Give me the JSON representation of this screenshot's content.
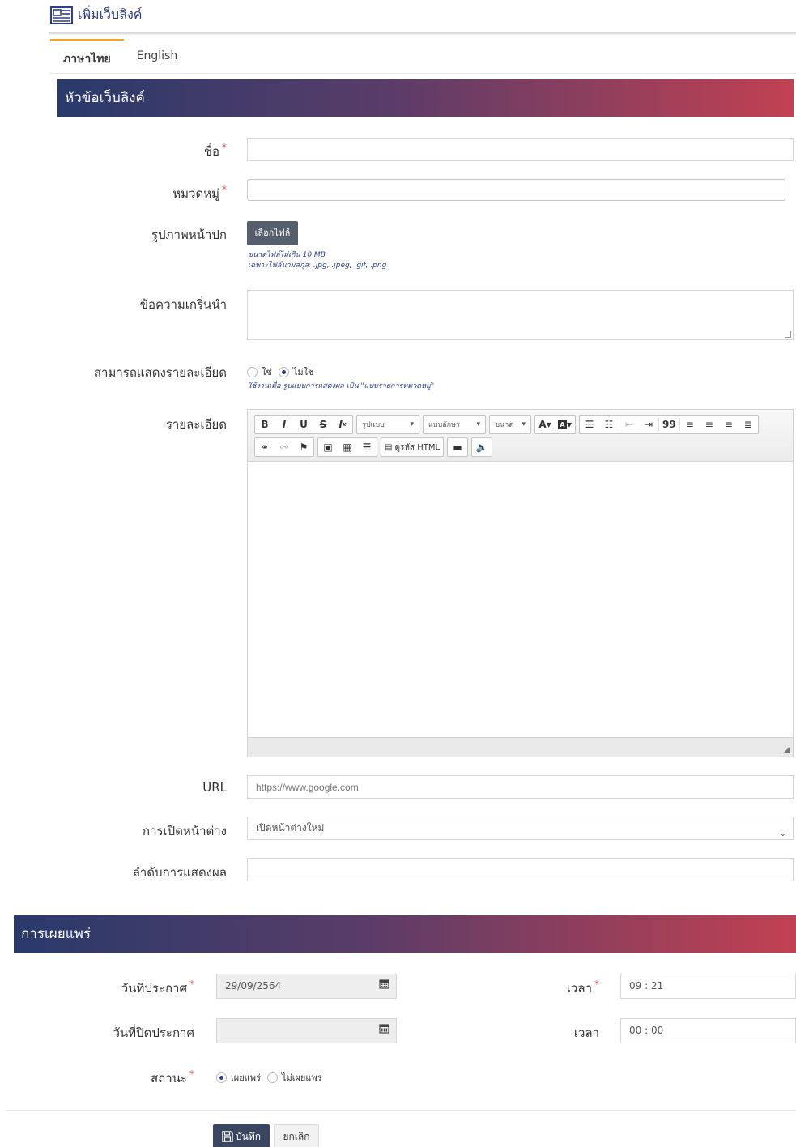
{
  "page": {
    "title": "เพิ่มเว็บลิงค์"
  },
  "tabs": [
    {
      "label": "ภาษาไทย",
      "active": true
    },
    {
      "label": "English",
      "active": false
    }
  ],
  "section_main": {
    "title": "หัวข้อเว็บลิงค์"
  },
  "form": {
    "name": {
      "label": "ชื่อ",
      "required_mark": "*",
      "value": ""
    },
    "category": {
      "label": "หมวดหมู่",
      "required_mark": "*",
      "value": ""
    },
    "cover_image": {
      "label": "รูปภาพหน้าปก",
      "button_label": "เลือกไฟล์",
      "hint_line1": "ขนาดไฟล์ไม่เกิน 10 MB",
      "hint_line2": "เฉพาะไฟล์นามสกุล: .jpg, .jpeg, .gif, .png"
    },
    "intro": {
      "label": "ข้อความเกริ่นนำ",
      "value": ""
    },
    "show_detail": {
      "label": "สามารถแสดงรายละเอียด",
      "option_yes": "ใช่",
      "option_no": "ไม่ใช่",
      "selected": "ไม่ใช่",
      "hint": "ใช้งานเมื่อ รูปแบบการแสดงผล เป็น \"แบบรายการหมวดหมู่\""
    },
    "detail": {
      "label": "รายละเอียด",
      "toolbar": {
        "format_label": "รูปแบบ",
        "font_label": "แบบอักษร",
        "size_label": "ขนาด",
        "source_label": "ดูรหัส HTML",
        "quote_glyph": "99"
      }
    },
    "url": {
      "label": "URL",
      "placeholder": "https://www.google.com",
      "value": ""
    },
    "open_window": {
      "label": "การเปิดหน้าต่าง",
      "selected": "เปิดหน้าต่างใหม่"
    },
    "display_order": {
      "label": "ลำดับการแสดงผล",
      "value": ""
    }
  },
  "section_publish": {
    "title": "การเผยแพร่"
  },
  "publish": {
    "announce_date": {
      "label": "วันที่ประกาศ",
      "required_mark": "*",
      "value": "29/09/2564"
    },
    "announce_time": {
      "label": "เวลา",
      "required_mark": "*",
      "value": "09 : 21"
    },
    "close_date": {
      "label": "วันที่ปิดประกาศ",
      "value": ""
    },
    "close_time": {
      "label": "เวลา",
      "value": "00 : 00"
    },
    "status": {
      "label": "สถานะ",
      "required_mark": "*",
      "option_publish": "เผยแพร่",
      "option_unpublish": "ไม่เผยแพร่",
      "selected": "เผยแพร่"
    }
  },
  "actions": {
    "save_label": "บันทึก",
    "cancel_label": "ยกเลิก"
  },
  "colors": {
    "accent": "#2d3e8c",
    "tab_active": "#f5a623",
    "bar_start": "#283a6b",
    "bar_end": "#c24152",
    "required": "#d9534f"
  }
}
